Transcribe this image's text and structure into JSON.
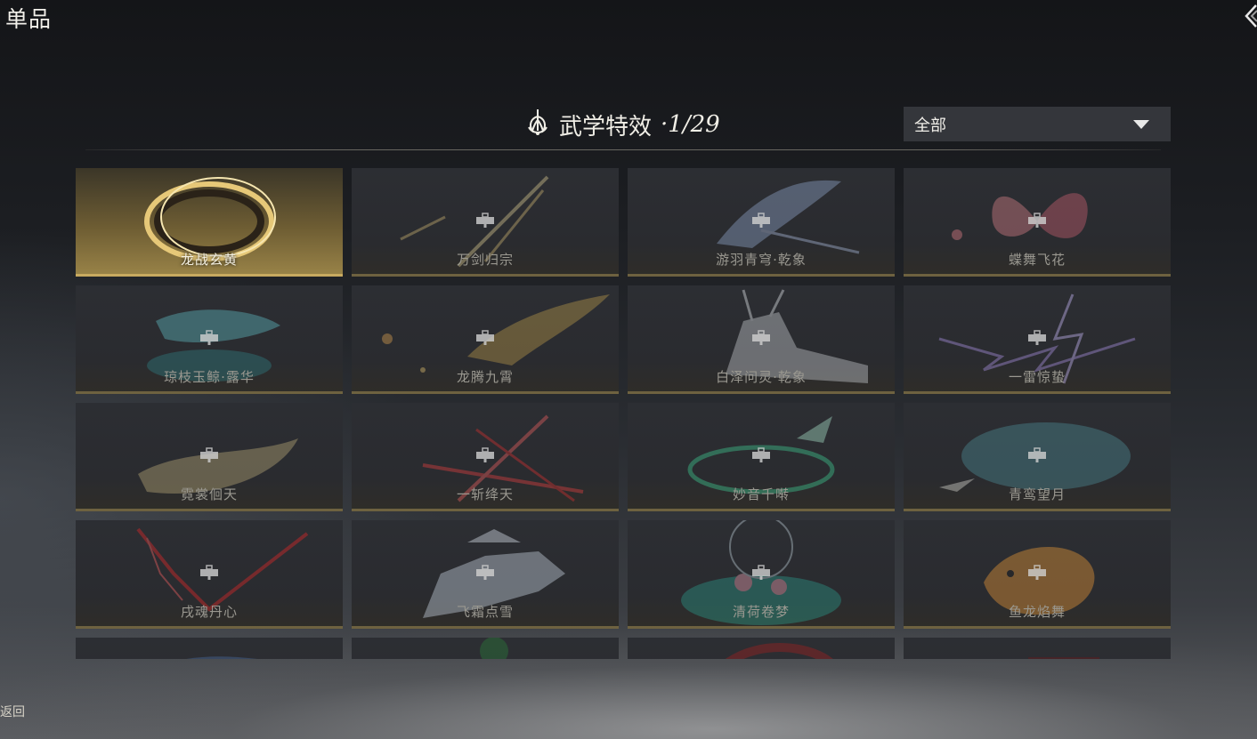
{
  "page": {
    "title": "单品",
    "back_label": "返回"
  },
  "section": {
    "title": "武学特效",
    "progress": "·1/29"
  },
  "filter": {
    "selected": "全部"
  },
  "cards": [
    {
      "name": "龙战玄黄",
      "unlocked": true,
      "icon": "dragon-ring-art"
    },
    {
      "name": "万剑归宗",
      "unlocked": false,
      "icon": "swords-art"
    },
    {
      "name": "游羽青穹·乾象",
      "unlocked": false,
      "icon": "crane-art"
    },
    {
      "name": "蝶舞飞花",
      "unlocked": false,
      "icon": "butterfly-art"
    },
    {
      "name": "琼枝玉鲸·露华",
      "unlocked": false,
      "icon": "whale-art"
    },
    {
      "name": "龙腾九霄",
      "unlocked": false,
      "icon": "golden-dragon-art"
    },
    {
      "name": "白泽问灵·乾象",
      "unlocked": false,
      "icon": "deer-art"
    },
    {
      "name": "一雷惊蛰",
      "unlocked": false,
      "icon": "lightning-art"
    },
    {
      "name": "霓裳佪天",
      "unlocked": false,
      "icon": "moon-dancer-art"
    },
    {
      "name": "一斩绛天",
      "unlocked": false,
      "icon": "red-slash-art"
    },
    {
      "name": "妙音千啭",
      "unlocked": false,
      "icon": "bird-swirl-art"
    },
    {
      "name": "青鸾望月",
      "unlocked": false,
      "icon": "blue-bird-moon-art"
    },
    {
      "name": "戌魂丹心",
      "unlocked": false,
      "icon": "red-spear-art"
    },
    {
      "name": "飞霜点雪",
      "unlocked": false,
      "icon": "pavilion-art"
    },
    {
      "name": "清荷卷梦",
      "unlocked": false,
      "icon": "lotus-art"
    },
    {
      "name": "鱼龙焰舞",
      "unlocked": false,
      "icon": "koi-art"
    },
    {
      "name": "",
      "unlocked": false,
      "icon": "blue-art"
    },
    {
      "name": "",
      "unlocked": false,
      "icon": "green-art"
    },
    {
      "name": "",
      "unlocked": false,
      "icon": "crimson-art"
    },
    {
      "name": "",
      "unlocked": false,
      "icon": "dark-red-art"
    }
  ],
  "colors": {
    "accent_gold": "#c8aa60",
    "card_bg": "#2b2d32",
    "dropdown_bg": "#34363b"
  }
}
